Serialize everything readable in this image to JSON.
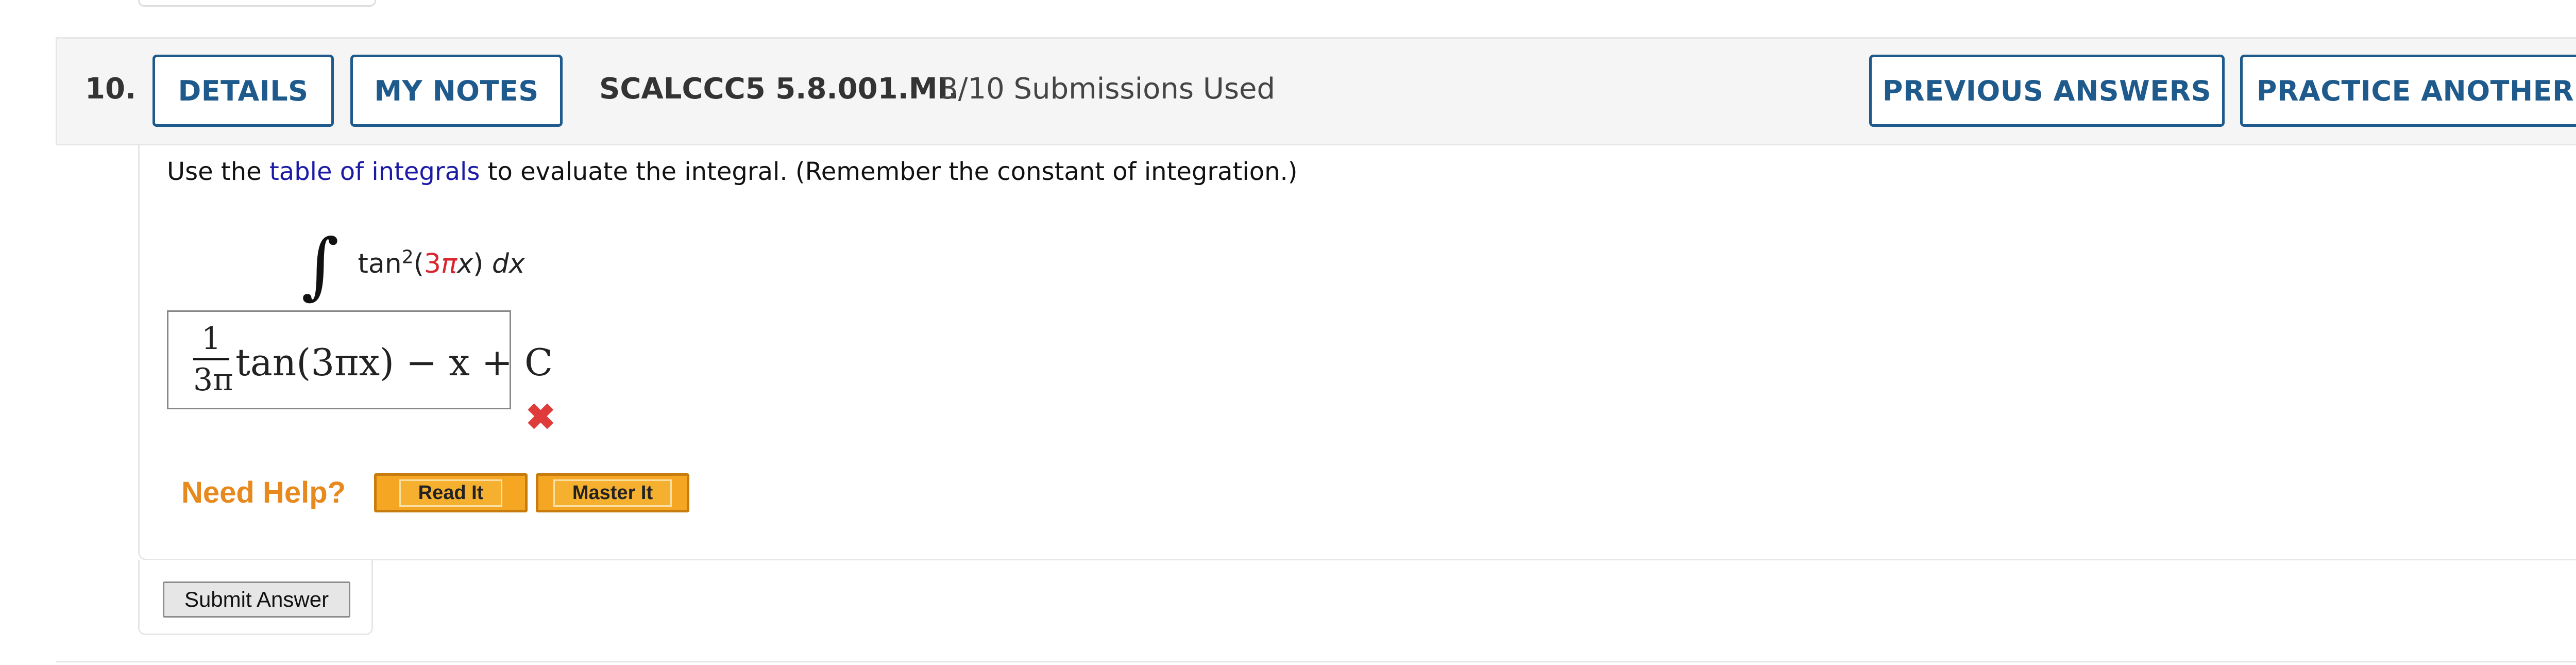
{
  "question": {
    "number": "10.",
    "details_label": "DETAILS",
    "my_notes_label": "MY NOTES",
    "code": "SCALCCC5 5.8.001.MI.",
    "submissions": "3/10 Submissions Used",
    "previous_answers_label": "PREVIOUS ANSWERS",
    "practice_another_label": "PRACTICE ANOTHER"
  },
  "body": {
    "instruction_prefix": "Use the",
    "table_link": "table of integrals",
    "instruction_suffix": "to evaluate the integral. (Remember the constant of integration.)",
    "integral": {
      "sign": "∫",
      "func": "tan",
      "power": "2",
      "open": "(",
      "coef": "3",
      "pi": "π",
      "var": "x",
      "close": ")",
      "dx": "dx"
    },
    "answer": {
      "numerator": "1",
      "denominator": "3π",
      "expression": "tan(3πx) − x + C"
    },
    "status_icon": "incorrect-x-icon",
    "status_glyph": "✖"
  },
  "help": {
    "label": "Need Help?",
    "read_it": "Read It",
    "master_it": "Master It"
  },
  "submit_label": "Submit Answer",
  "colors": {
    "accent": "#1f5a8c",
    "link": "#1a1aa6",
    "error": "#e03b3b",
    "help_orange": "#e8891d",
    "integral_red": "#d8262f"
  }
}
